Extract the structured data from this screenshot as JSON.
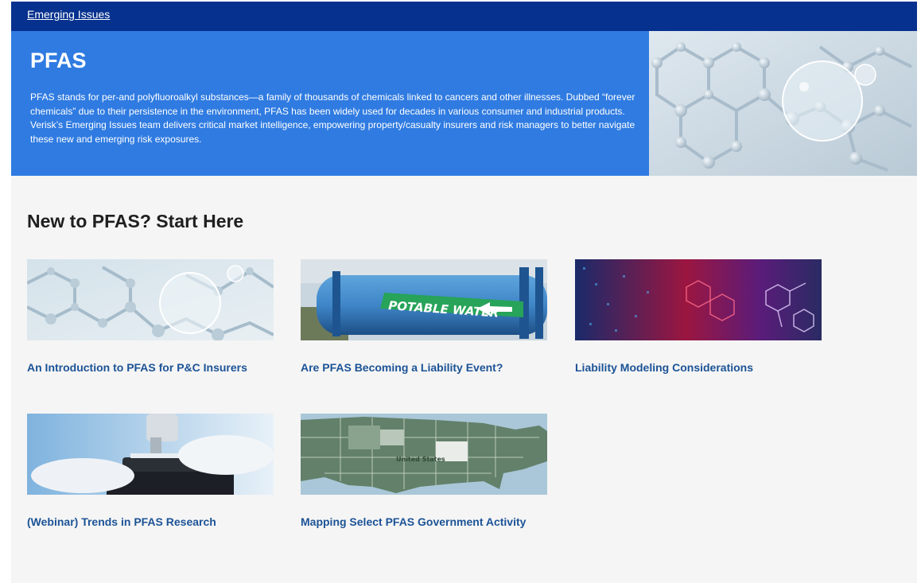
{
  "breadcrumb": {
    "label": "Emerging Issues"
  },
  "hero": {
    "title": "PFAS",
    "description": "PFAS stands for per-and polyfluoroalkyl substances—a family of thousands of chemicals linked to cancers and other illnesses. Dubbed “forever chemicals” due to their persistence in the environment, PFAS has been widely used for decades in various consumer and industrial products. Verisk’s Emerging Issues team delivers critical market intelligence, empowering property/casualty insurers and risk managers to better navigate these new and emerging risk exposures."
  },
  "section": {
    "title": "New to PFAS? Start Here",
    "cards": [
      {
        "title": "An Introduction to PFAS for P&C Insurers",
        "image": "molecule-bubble"
      },
      {
        "title": "Are PFAS Becoming a Liability Event?",
        "image": "potable-water-pipe",
        "image_text": "POTABLE WATER"
      },
      {
        "title": "Liability Modeling Considerations",
        "image": "chemical-structure-abstract"
      },
      {
        "title": "(Webinar) Trends in PFAS Research",
        "image": "microscope-lab"
      },
      {
        "title": "Mapping Select PFAS Government Activity",
        "image": "us-map",
        "image_text": "United States"
      }
    ]
  },
  "colors": {
    "topbar": "#06318e",
    "hero_bg": "#2f7be1",
    "link": "#1c5396",
    "page_bg": "#f5f5f5"
  }
}
